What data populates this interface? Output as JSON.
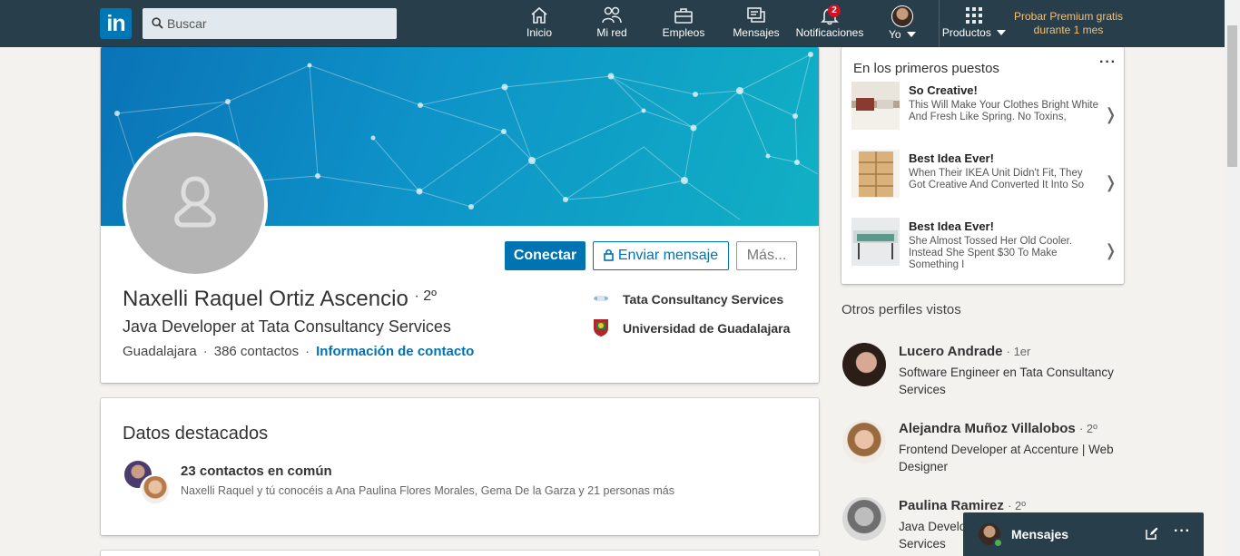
{
  "nav": {
    "logo": "in",
    "search_placeholder": "Buscar",
    "items": [
      {
        "label": "Inicio",
        "icon": "home-icon"
      },
      {
        "label": "Mi red",
        "icon": "network-icon"
      },
      {
        "label": "Empleos",
        "icon": "briefcase-icon"
      },
      {
        "label": "Mensajes",
        "icon": "messages-icon"
      },
      {
        "label": "Notificaciones",
        "icon": "bell-icon",
        "badge": "2"
      },
      {
        "label": "Yo",
        "icon": "user-avatar"
      },
      {
        "label": "Productos",
        "icon": "grid-icon"
      }
    ],
    "premium_line1": "Probar Premium gratis",
    "premium_line2": "durante 1 mes"
  },
  "profile": {
    "name": "Naxelli Raquel Ortiz Ascencio",
    "degree": "2º",
    "headline": "Java Developer at Tata Consultancy Services",
    "location": "Guadalajara",
    "connections": "386 contactos",
    "contact_info": "Información de contacto",
    "buttons": {
      "connect": "Conectar",
      "message": "Enviar mensaje",
      "more": "Más..."
    },
    "experience": [
      {
        "name": "Tata Consultancy Services"
      },
      {
        "name": "Universidad de Guadalajara"
      }
    ]
  },
  "highlights": {
    "title": "Datos destacados",
    "common_count": "23 contactos en común",
    "common_desc": "Naxelli Raquel y tú conocéis a Ana Paulina Flores Morales, Gema De la Garza y 21 personas más"
  },
  "promo": {
    "title": "En los primeros puestos",
    "menu": "···",
    "items": [
      {
        "title": "So Creative!",
        "text": "This Will Make Your Clothes Bright White And Fresh Like Spring. No Toxins,"
      },
      {
        "title": "Best Idea Ever!",
        "text": "When Their IKEA Unit Didn't Fit, They Got Creative And Converted It Into So"
      },
      {
        "title": "Best Idea Ever!",
        "text": "She Almost Tossed Her Old Cooler. Instead She Spent $30 To Make Something I"
      }
    ],
    "chevron": "❭"
  },
  "others": {
    "title": "Otros perfiles vistos",
    "people": [
      {
        "name": "Lucero Andrade",
        "degree": "· 1er",
        "title": "Software Engineer en Tata Consultancy Services"
      },
      {
        "name": "Alejandra Muñoz Villalobos",
        "degree": "· 2º",
        "title": "Frontend Developer at Accenture | Web Designer"
      },
      {
        "name": "Paulina Ramirez",
        "degree": "· 2º",
        "title": "Java Developer at Tata Consultancy Services"
      }
    ]
  },
  "messaging": {
    "label": "Mensajes",
    "menu": "···"
  },
  "colors": {
    "brand": "#0073b1",
    "nav_bg": "#283e4a",
    "premium": "#f5c075",
    "badge": "#d11124"
  }
}
